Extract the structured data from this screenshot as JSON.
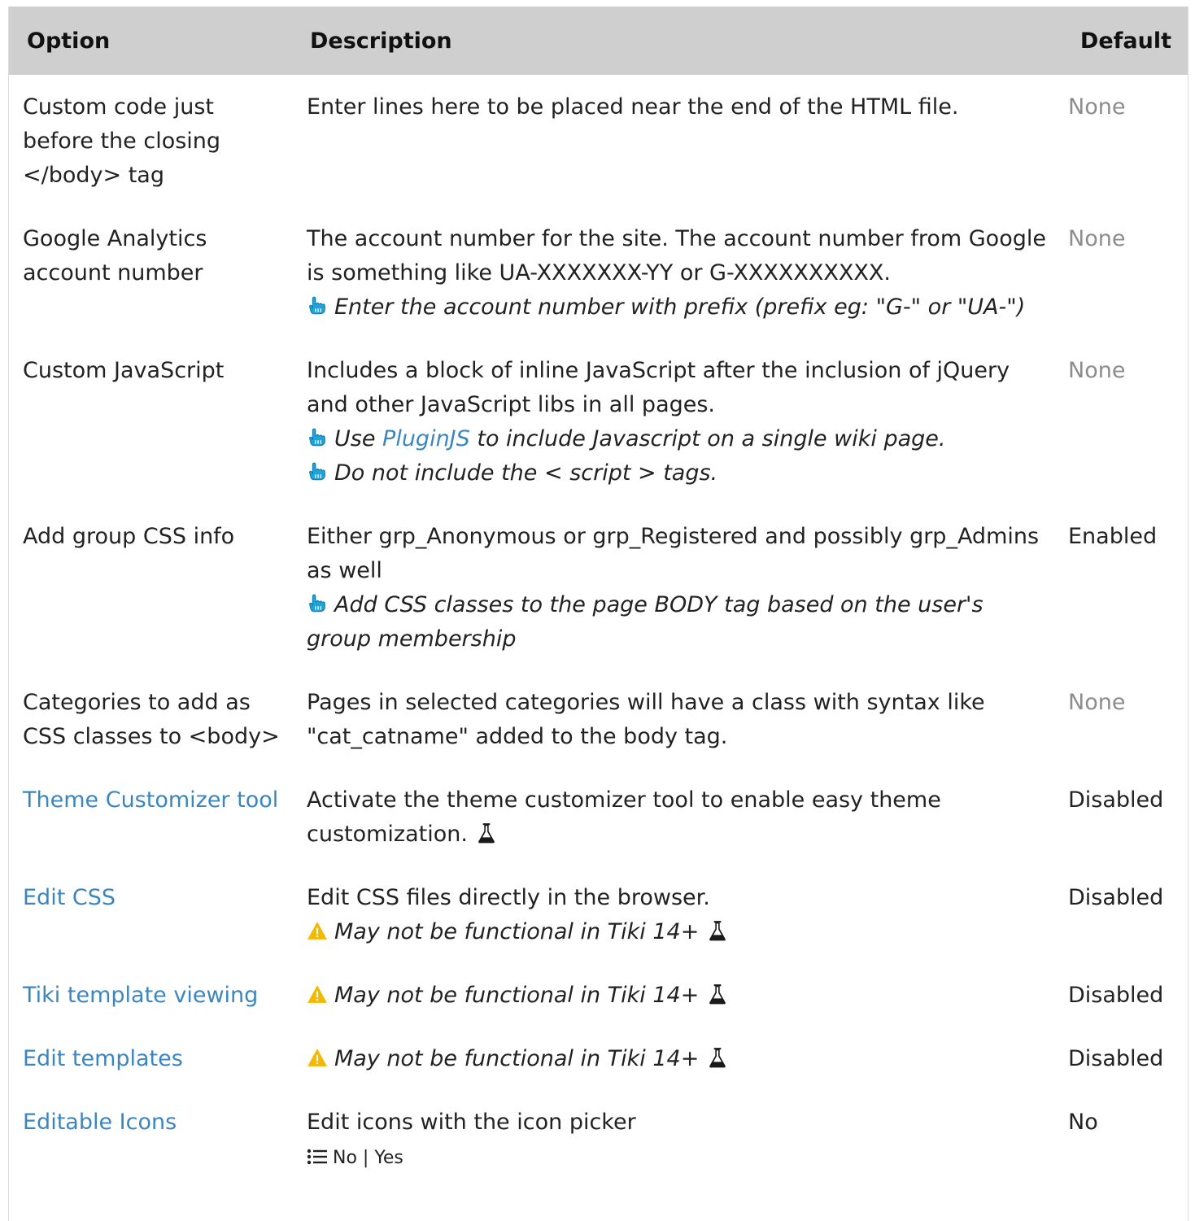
{
  "table": {
    "headers": {
      "option": "Option",
      "description": "Description",
      "default": "Default"
    },
    "rows": [
      {
        "option": "Custom code just before the closing </body> tag",
        "description": "Enter lines here to be placed near the end of the HTML file.",
        "default": "None"
      },
      {
        "option": "Google Analytics account number",
        "description": "The account number for the site. The account number from Google is something like UA-XXXXXXX-YY or G-XXXXXXXXXX.",
        "tip": "Enter the account number with prefix (prefix eg: \"G-\" or \"UA-\")",
        "default": "None"
      },
      {
        "option": "Custom JavaScript",
        "description": "Includes a block of inline JavaScript after the inclusion of jQuery and other JavaScript libs in all pages.",
        "tip1_before": "Use ",
        "tip1_link": "PluginJS",
        "tip1_after": " to include Javascript on a single wiki page.",
        "tip2": "Do not include the < script > tags.",
        "default": "None"
      },
      {
        "option": "Add group CSS info",
        "description": "Either grp_Anonymous or grp_Registered and possibly grp_Admins as well",
        "tip": "Add CSS classes to the page BODY tag based on the user's group membership",
        "default": "Enabled"
      },
      {
        "option": "Categories to add as CSS classes to <body>",
        "description": "Pages in selected categories will have a class with syntax like \"cat_catname\" added to the body tag.",
        "default": "None"
      },
      {
        "option": "Theme Customizer tool",
        "description": "Activate the theme customizer tool to enable easy theme customization.",
        "default": "Disabled"
      },
      {
        "option": "Edit CSS",
        "description": "Edit CSS files directly in the browser.",
        "warning": "May not be functional in Tiki 14+",
        "default": "Disabled"
      },
      {
        "option": "Tiki template viewing",
        "warning": "May not be functional in Tiki 14+",
        "default": "Disabled"
      },
      {
        "option": "Edit templates",
        "warning": "May not be functional in Tiki 14+",
        "default": "Disabled"
      },
      {
        "option": "Editable Icons",
        "description": "Edit icons with the icon picker",
        "options_choice1": "No",
        "options_separator": " | ",
        "options_choice2": "Yes",
        "default": "No"
      }
    ]
  },
  "colors": {
    "header_bg": "#cfcfcf",
    "link": "#3b86bf",
    "muted": "#8c8c8c",
    "tip_icon": "#1fa3d9",
    "warning_icon": "#f5b800"
  },
  "icons": {
    "tip": "pointing-hand-icon",
    "warning": "warning-triangle-icon",
    "experimental": "flask-icon",
    "options_list": "list-icon"
  }
}
